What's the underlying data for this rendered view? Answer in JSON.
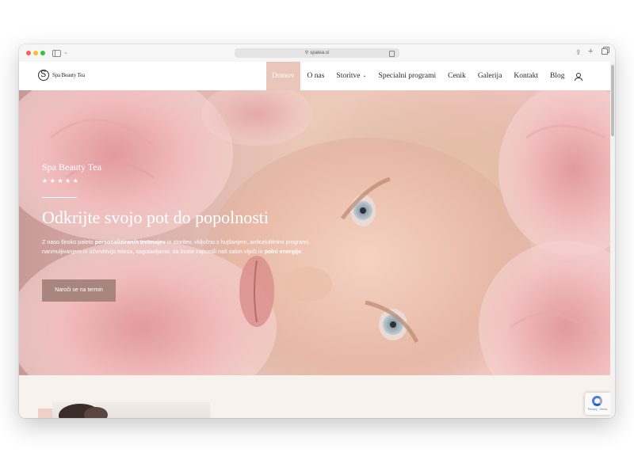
{
  "browser": {
    "url": "spatea.si",
    "site_icon": "spatea-favicon-icon",
    "toolbar_icons": [
      "sidebar-icon",
      "share-icon",
      "plus-icon",
      "tabs-icon"
    ]
  },
  "header": {
    "logo_text": "Spa Beauty Tea",
    "nav": [
      {
        "label": "Domov",
        "active": true
      },
      {
        "label": "O nas"
      },
      {
        "label": "Storitve",
        "has_dropdown": true
      },
      {
        "label": "Specialni programi"
      },
      {
        "label": "Cenik"
      },
      {
        "label": "Galerija"
      },
      {
        "label": "Kontakt"
      },
      {
        "label": "Blog"
      }
    ],
    "account_icon": "user-icon"
  },
  "hero": {
    "brand": "Spa Beauty Tea",
    "stars": "★★★★★",
    "rating": 5,
    "title": "Odkrijte svojo pot do popolnosti",
    "desc_1": "Z naso široko paleto ",
    "desc_bold_1": "personaliziranih tretmajev",
    "desc_2": " in storitev, vključno s hujšanjem, anticelulitnimi programi, nanmuljivanjem in učvrstitvijo telesa, zagotavljamo, da boste zapustili naš salon vijoči in ",
    "desc_bold_2": "polni energije",
    "desc_3": ".",
    "cta": "Naroči se na termin"
  },
  "recaptcha": {
    "text": "Privacy - Terms"
  },
  "colors": {
    "accent": "#e9c6b9",
    "cta": "#a8857f",
    "section_bg": "#f7f2ee"
  }
}
